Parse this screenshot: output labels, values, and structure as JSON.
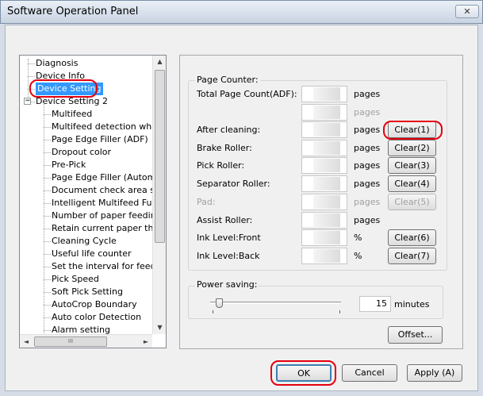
{
  "window": {
    "title": "Software Operation Panel",
    "close_glyph": "✕"
  },
  "tree": {
    "items": [
      {
        "label": "Diagnosis"
      },
      {
        "label": "Device Info"
      },
      {
        "label": "Device Setting"
      },
      {
        "label": "Device Setting 2",
        "expander": "−"
      },
      {
        "label": "Multifeed"
      },
      {
        "label": "Multifeed detection when s"
      },
      {
        "label": "Page Edge Filler (ADF)"
      },
      {
        "label": "Dropout color"
      },
      {
        "label": "Pre-Pick"
      },
      {
        "label": "Page Edge Filler (Automatio"
      },
      {
        "label": "Document check area spe"
      },
      {
        "label": "Intelligent Multifeed Functio"
      },
      {
        "label": "Number of paper feeding re"
      },
      {
        "label": "Retain current paper thickn"
      },
      {
        "label": "Cleaning Cycle"
      },
      {
        "label": "Useful life counter"
      },
      {
        "label": "Set the interval for feeding"
      },
      {
        "label": "Pick Speed"
      },
      {
        "label": "Soft Pick Setting"
      },
      {
        "label": "AutoCrop Boundary"
      },
      {
        "label": "Auto color Detection"
      },
      {
        "label": "Alarm setting"
      }
    ],
    "scroll_up": "▲",
    "scroll_down": "▼",
    "scroll_left": "◄",
    "scroll_right": "►",
    "hthumb_grip": "III"
  },
  "page_counter": {
    "title": "Page Counter:",
    "rows": [
      {
        "label": "Total Page Count(ADF):",
        "unit": "pages",
        "button": ""
      },
      {
        "label": "",
        "unit": "pages",
        "button": ""
      },
      {
        "label": "After cleaning:",
        "unit": "pages",
        "button": "Clear(1)"
      },
      {
        "label": "Brake Roller:",
        "unit": "pages",
        "button": "Clear(2)"
      },
      {
        "label": "Pick Roller:",
        "unit": "pages",
        "button": "Clear(3)"
      },
      {
        "label": "Separator Roller:",
        "unit": "pages",
        "button": "Clear(4)"
      },
      {
        "label": "Pad:",
        "unit": "pages",
        "button": "Clear(5)"
      },
      {
        "label": "Assist Roller:",
        "unit": "pages",
        "button": ""
      },
      {
        "label": "Ink Level:Front",
        "unit": "%",
        "button": "Clear(6)"
      },
      {
        "label": "Ink Level:Back",
        "unit": "%",
        "button": "Clear(7)"
      }
    ]
  },
  "power_saving": {
    "title": "Power saving:",
    "value": "15",
    "unit": "minutes",
    "slider_level": 0.05
  },
  "buttons": {
    "offset": "Offset...",
    "ok": "OK",
    "cancel": "Cancel",
    "apply": "Apply (A)"
  },
  "colors": {
    "selection": "#3399ff",
    "highlight_ring": "#e3000f"
  }
}
